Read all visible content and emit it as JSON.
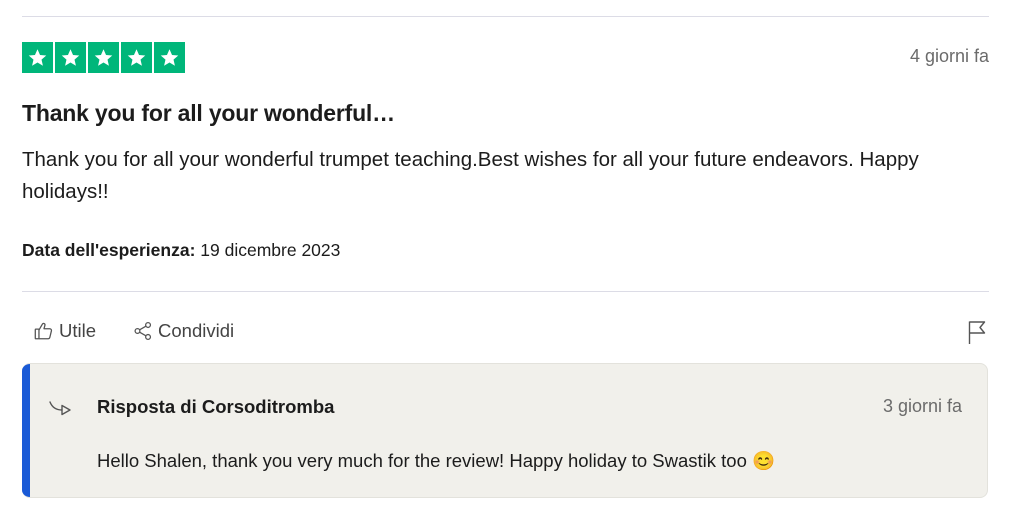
{
  "review": {
    "rating": 5,
    "rating_max": 5,
    "date": "4 giorni fa",
    "title": "Thank you for all your wonderful…",
    "body": "Thank you for all your wonderful trumpet teaching.Best wishes for all your future endeavors. Happy holidays!!",
    "experience_label": "Data dell'esperienza:",
    "experience_date": "19 dicembre 2023"
  },
  "actions": {
    "useful_label": "Utile",
    "share_label": "Condividi"
  },
  "reply": {
    "author": "Risposta di Corsoditromba",
    "date": "3 giorni fa",
    "text": "Hello Shalen, thank you very much for the review! Happy holiday to Swastik too 😊"
  },
  "colors": {
    "star": "#00b67a",
    "reply_accent": "#1a5ad6",
    "reply_background": "#f1f0eb"
  },
  "icons": [
    "star-icon",
    "thumbs-up-icon",
    "share-icon",
    "flag-icon",
    "reply-arrow-icon"
  ]
}
